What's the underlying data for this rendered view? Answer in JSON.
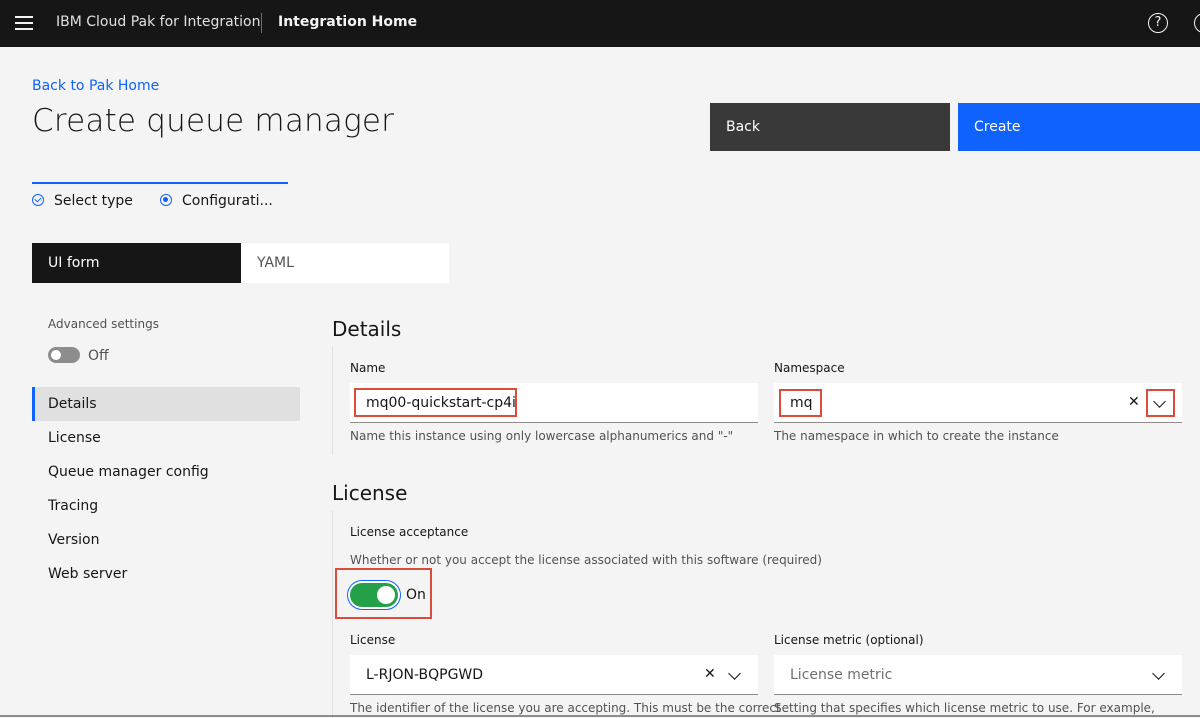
{
  "header": {
    "brand": "IBM Cloud Pak for Integration",
    "page_name": "Integration Home",
    "help_icon_glyph": "?"
  },
  "page": {
    "back_link": "Back to Pak Home",
    "title": "Create queue manager",
    "back_button": "Back",
    "create_button": "Create"
  },
  "steps": [
    {
      "label": "Select type",
      "state": "complete"
    },
    {
      "label": "Configurati...",
      "state": "current"
    }
  ],
  "switcher": {
    "ui_form": "UI form",
    "yaml": "YAML",
    "selected": "UI form"
  },
  "sidebar": {
    "advanced_label": "Advanced settings",
    "advanced_state": "Off",
    "items": [
      {
        "label": "Details",
        "active": true
      },
      {
        "label": "License"
      },
      {
        "label": "Queue manager config"
      },
      {
        "label": "Tracing"
      },
      {
        "label": "Version"
      },
      {
        "label": "Web server"
      }
    ]
  },
  "details": {
    "title": "Details",
    "name": {
      "label": "Name",
      "value": "mq00-quickstart-cp4i",
      "helper": "Name this instance using only lowercase alphanumerics and \"-\""
    },
    "namespace": {
      "label": "Namespace",
      "value": "mq",
      "helper": "The namespace in which to create the instance"
    }
  },
  "license": {
    "title": "License",
    "acceptance_label": "License acceptance",
    "acceptance_helper": "Whether or not you accept the license associated with this software (required)",
    "acceptance_state": "On",
    "license_field": {
      "label": "License",
      "value": "L-RJON-BQPGWD",
      "helper": "The identifier of the license you are accepting. This must be the correct"
    },
    "metric_field": {
      "label": "License metric (optional)",
      "placeholder": "License metric",
      "helper": "Setting that specifies which license metric to use. For example,"
    }
  },
  "colors": {
    "primary": "#0f62fe",
    "highlight": "#da4c3c",
    "toggle_on": "#24a148",
    "header_bg": "#161616"
  }
}
